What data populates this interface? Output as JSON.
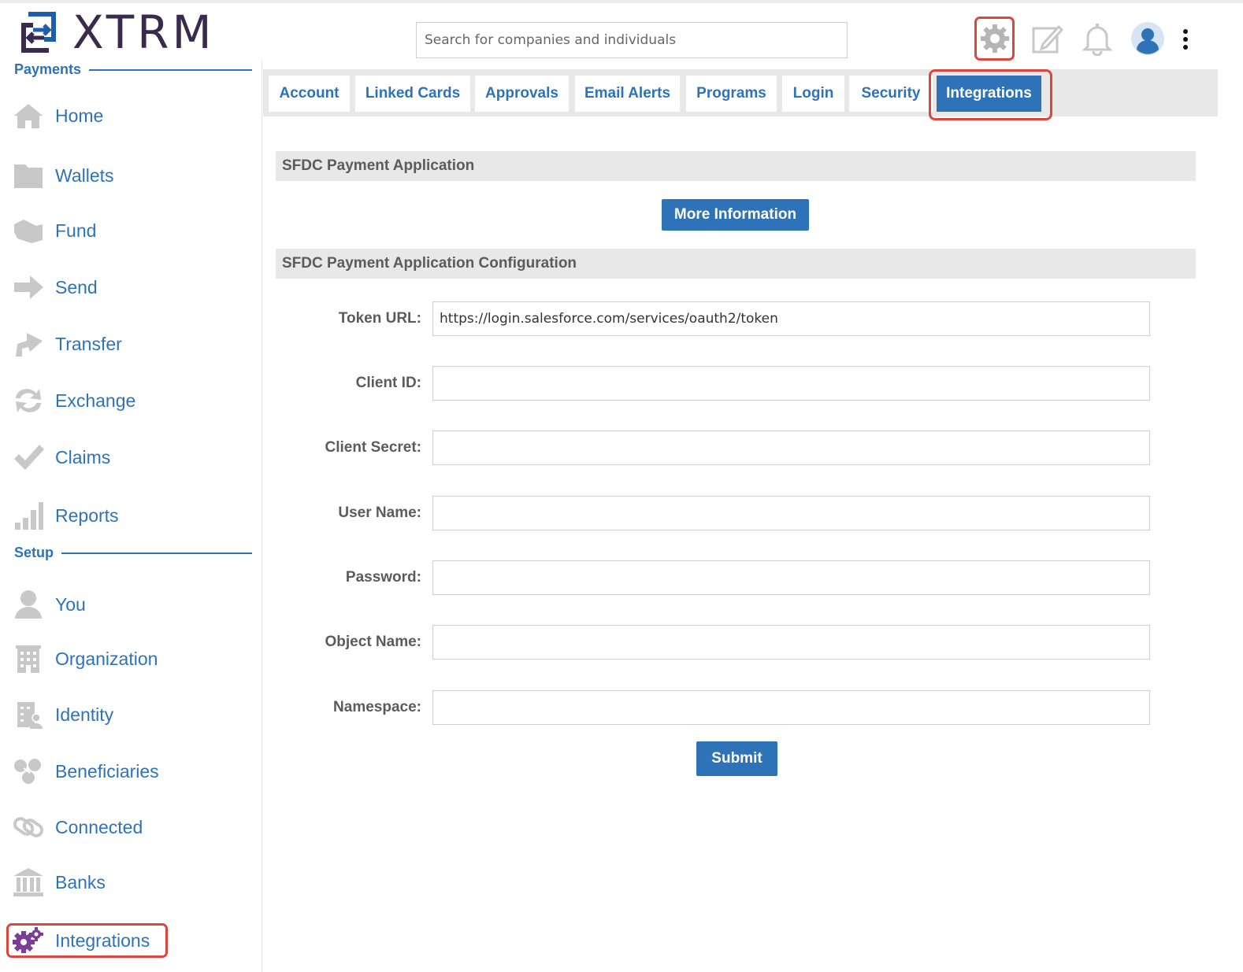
{
  "brand": {
    "name": "XTRM"
  },
  "search": {
    "placeholder": "Search for companies and individuals"
  },
  "sidebar": {
    "payments_header": "Payments",
    "payments_items": [
      {
        "label": "Home",
        "icon": "home-icon"
      },
      {
        "label": "Wallets",
        "icon": "folder-icon"
      },
      {
        "label": "Fund",
        "icon": "hand-money-icon"
      },
      {
        "label": "Send",
        "icon": "arrow-right-icon"
      },
      {
        "label": "Transfer",
        "icon": "arrow-up-right-icon"
      },
      {
        "label": "Exchange",
        "icon": "exchange-icon"
      },
      {
        "label": "Claims",
        "icon": "checkmark-icon"
      },
      {
        "label": "Reports",
        "icon": "bar-chart-icon"
      }
    ],
    "setup_header": "Setup",
    "setup_items": [
      {
        "label": "You",
        "icon": "user-icon"
      },
      {
        "label": "Organization",
        "icon": "building-icon"
      },
      {
        "label": "Identity",
        "icon": "identity-icon"
      },
      {
        "label": "Beneficiaries",
        "icon": "people-icon"
      },
      {
        "label": "Connected",
        "icon": "link-icon"
      },
      {
        "label": "Banks",
        "icon": "bank-icon"
      },
      {
        "label": "Integrations",
        "icon": "gears-icon"
      }
    ]
  },
  "tabs": [
    "Account",
    "Linked Cards",
    "Approvals",
    "Email Alerts",
    "Programs",
    "Login",
    "Security",
    "Integrations"
  ],
  "active_tab": "Integrations",
  "main": {
    "section1_title": "SFDC Payment Application",
    "more_info_label": "More Information",
    "section2_title": "SFDC Payment Application Configuration",
    "fields": [
      {
        "label": "Token URL:",
        "value": "https://login.salesforce.com/services/oauth2/token"
      },
      {
        "label": "Client ID:",
        "value": ""
      },
      {
        "label": "Client Secret:",
        "value": ""
      },
      {
        "label": "User Name:",
        "value": ""
      },
      {
        "label": "Password:",
        "value": ""
      },
      {
        "label": "Object Name:",
        "value": ""
      },
      {
        "label": "Namespace:",
        "value": ""
      }
    ],
    "submit_label": "Submit"
  },
  "colors": {
    "accent": "#2e73b8",
    "highlight": "#d9473e",
    "icon_gray": "#c8c8c8",
    "active_icon": "#7a3e97"
  }
}
